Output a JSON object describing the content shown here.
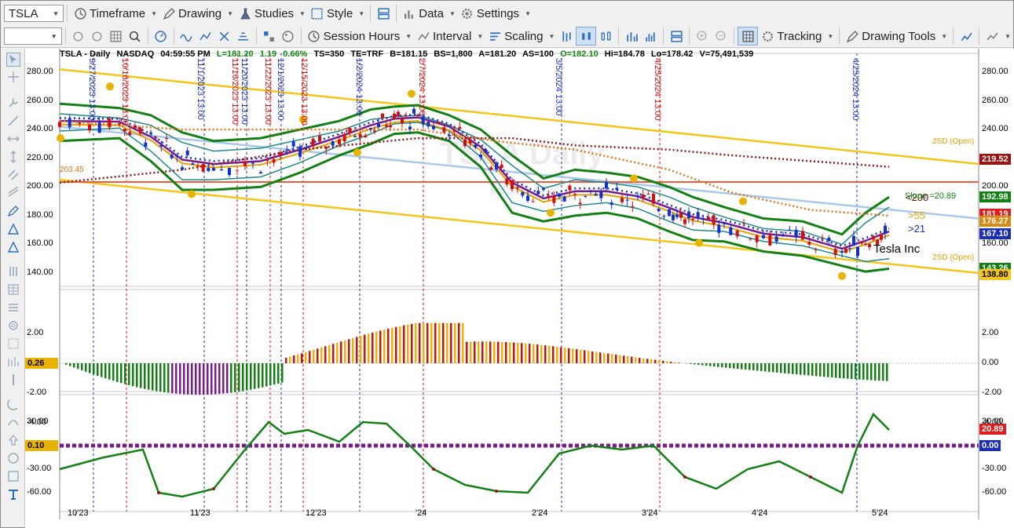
{
  "toolbar": {
    "symbol": "TSLA",
    "timeframe": "Timeframe",
    "drawing": "Drawing",
    "studies": "Studies",
    "style": "Style",
    "data": "Data",
    "settings": "Settings",
    "blank_combo": "",
    "session_hours": "Session Hours",
    "interval": "Interval",
    "scaling": "Scaling",
    "tracking": "Tracking",
    "drawing_tools": "Drawing Tools"
  },
  "chart_header": {
    "title": "TSLA - Daily",
    "exchange": "NASDAQ",
    "time": "04:59:55 PM",
    "last": "L=181.20",
    "change": "1.19",
    "pct": "0.66%",
    "ts": "TS=350",
    "te": "TE=TRF",
    "bid": "B=181.15",
    "bs": "BS=1,800",
    "ask": "A=181.20",
    "as": "AS=100",
    "open": "O=182.10",
    "hi": "Hi=184.78",
    "lo": "Lo=178.42",
    "vol": "V=75,491,539"
  },
  "watermark": {
    "title": "TSLA Daily",
    "name": "Tesla Inc"
  },
  "annotations": {
    "slope": "Slope =20.89",
    "ma200": "<200",
    "ma55": ">55",
    "ma21": ">21",
    "sd_open_top": "2SD (Open)",
    "sd_open_bottom": "2SD (Open)",
    "company": "Tesla Inc",
    "left_level": "203.45"
  },
  "session_markers": [
    "9/27/2023 13:00",
    "10/16/2023 13:00",
    "11/1/2023 13:00",
    "11/16/2023 13:00",
    "11/20/2023 13:00",
    "11/22/2023 13:00",
    "12/1/2023 13:00",
    "12/15/2023 13:00",
    "1/2/2024 13:00",
    "2/7/2024 13:00",
    "3/5/2024 13:00",
    "4/25/2024 13:00"
  ],
  "price_axis": [
    "280.00",
    "260.00",
    "240.00",
    "220.00",
    "200.00",
    "180.00",
    "160.00",
    "140.00"
  ],
  "price_tags": [
    {
      "value": "219.52",
      "color": "#9b1313"
    },
    {
      "value": "192.98",
      "color": "#138013"
    },
    {
      "value": "181.19",
      "color": "#e01b1b"
    },
    {
      "value": "176.27",
      "color": "#d98c13"
    },
    {
      "value": "167.10",
      "color": "#1a2fb8"
    },
    {
      "value": "143.26",
      "color": "#138013"
    },
    {
      "value": "138.80",
      "color": "#f5c518"
    }
  ],
  "hist_axis": [
    "2.00",
    "0.00",
    "-2.00",
    "-4.00"
  ],
  "hist_tag": "0.26",
  "osc_axis": [
    "30.00",
    "0.00",
    "-30.00",
    "-60.00"
  ],
  "osc_tags": [
    {
      "value": "20.89",
      "color": "#e01b1b"
    },
    {
      "value": "0.00",
      "color": "#1a2fb8"
    }
  ],
  "osc_left_tag": "0.10",
  "x_axis": [
    "10'23",
    "11'23",
    "12'23",
    "'24",
    "2'24",
    "3'24",
    "4'24",
    "5'24"
  ],
  "colors": {
    "up": "#1030d0",
    "down": "#d01010",
    "bb": "#1a8a1a",
    "fib": "#e8b400"
  }
}
